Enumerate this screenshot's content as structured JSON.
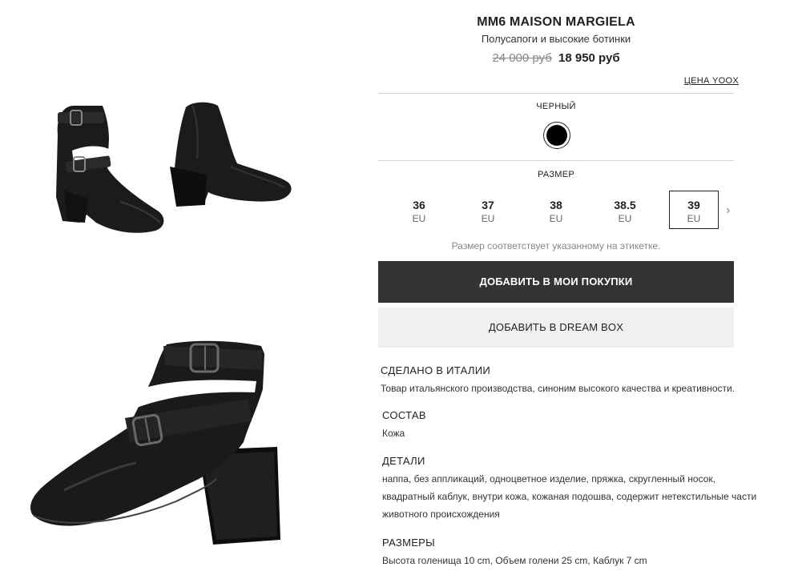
{
  "product": {
    "brand": "MM6 MAISON MARGIELA",
    "category": "Полусапоги и высокие ботинки",
    "price_old": "24 000 руб",
    "price_new": "18 950 руб",
    "yoox_price_link": "ЦЕНА YOOX"
  },
  "color": {
    "label": "ЧЕРНЫЙ",
    "swatch_hex": "#000000"
  },
  "size": {
    "label": "РАЗМЕР",
    "options": [
      {
        "value": "36",
        "unit": "EU"
      },
      {
        "value": "37",
        "unit": "EU"
      },
      {
        "value": "38",
        "unit": "EU"
      },
      {
        "value": "38.5",
        "unit": "EU"
      },
      {
        "value": "39",
        "unit": "EU"
      }
    ],
    "selected": "39",
    "next_icon": "chevron-right-icon",
    "note": "Размер соответствует указанному на этикетке."
  },
  "actions": {
    "buy_label": "ДОБАВИТЬ В МОИ ПОКУПКИ",
    "dreambox_label": "ДОБАВИТЬ В DREAM BOX"
  },
  "details": [
    {
      "title": "СДЕЛАНО В ИТАЛИИ",
      "text": "Товар итальянского производства, синоним высокого качества и креативности."
    },
    {
      "title": "СОСТАВ",
      "text": "Кожа"
    },
    {
      "title": "ДЕТАЛИ",
      "text": "наппа, без аппликаций, одноцветное изделие, пряжка, скругленный носок, квадратный каблук, внутри кожа, кожаная подошва, содержит нетекстильные части животного происхождения"
    },
    {
      "title": "РАЗМЕРЫ",
      "text": "Высота голенища 10 cm, Объем голени 25 cm, Каблук 7 cm"
    }
  ],
  "colors": {
    "primary_button": "#333333",
    "secondary_button": "#f0f0f0",
    "divider": "#d4d4d4"
  }
}
